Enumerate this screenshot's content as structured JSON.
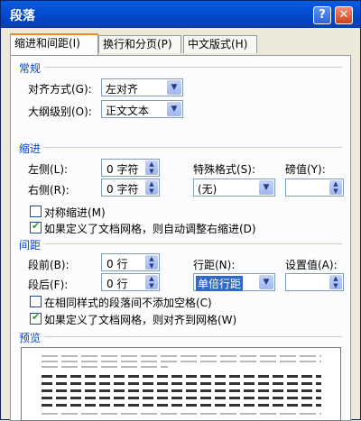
{
  "window": {
    "title": "段落",
    "help": "?",
    "close": "✕"
  },
  "tabs": [
    {
      "label": "缩进和间距(I)"
    },
    {
      "label": "换行和分页(P)"
    },
    {
      "label": "中文版式(H)"
    }
  ],
  "general": {
    "header": "常规",
    "alignment_label": "对齐方式(G):",
    "alignment_value": "左对齐",
    "outline_label": "大纲级别(O):",
    "outline_value": "正文文本"
  },
  "indent": {
    "header": "缩进",
    "left_label": "左侧(L):",
    "left_value": "0 字符",
    "right_label": "右侧(R):",
    "right_value": "0 字符",
    "special_label": "特殊格式(S):",
    "special_value": "(无)",
    "by_label": "磅值(Y):",
    "by_value": "",
    "mirror_label": "对称缩进(M)",
    "mirror_checked": false,
    "auto_adjust_label": "如果定义了文档网格，则自动调整右缩进(D)",
    "auto_adjust_checked": true
  },
  "spacing": {
    "header": "间距",
    "before_label": "段前(B):",
    "before_value": "0 行",
    "after_label": "段后(F):",
    "after_value": "0 行",
    "line_label": "行距(N):",
    "line_value": "单倍行距",
    "at_label": "设置值(A):",
    "at_value": "",
    "no_space_label": "在相同样式的段落间不添加空格(C)",
    "no_space_checked": false,
    "snap_grid_label": "如果定义了文档网格，则对齐到网格(W)",
    "snap_grid_checked": true
  },
  "preview": {
    "header": "预览"
  },
  "icons": {
    "dropdown": "chevron-down-icon",
    "spinner": "up-down-arrows-icon",
    "check": "checkmark-icon"
  }
}
